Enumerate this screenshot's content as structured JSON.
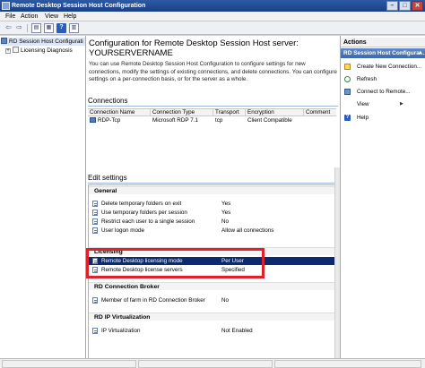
{
  "window": {
    "title": "Remote Desktop Session Host Configuration",
    "buttons": {
      "minimize": "–",
      "maximize": "□",
      "close": "✕"
    }
  },
  "menubar": {
    "items": [
      "File",
      "Action",
      "View",
      "Help"
    ]
  },
  "toolbar": {
    "back": "⇦",
    "forward": "⇨",
    "help": "?"
  },
  "tree": {
    "root": "RD Session Host Configurati",
    "child": "Licensing Diagnosis",
    "expander": "+"
  },
  "main": {
    "title": "Configuration for Remote Desktop Session Host server:",
    "server_name": "YOURSERVERNAME",
    "description": "You can use Remote Desktop Session Host Configuration to configure settings for new connections, modify the settings of existing connections, and delete connections. You can configure settings on a per-connection basis, or for the server as a whole.",
    "connections": {
      "title": "Connections",
      "columns": [
        "Connection Name",
        "Connection Type",
        "Transport",
        "Encryption",
        "Comment"
      ],
      "rows": [
        [
          "RDP-Tcp",
          "Microsoft RDP 7.1",
          "tcp",
          "Client Compatible",
          ""
        ]
      ]
    },
    "edit_settings": {
      "title": "Edit settings",
      "groups": [
        {
          "name": "General",
          "rows": [
            {
              "name": "Delete temporary folders on exit",
              "value": "Yes"
            },
            {
              "name": "Use temporary folders per session",
              "value": "Yes"
            },
            {
              "name": "Restrict each user to a single session",
              "value": "No"
            },
            {
              "name": "User logon mode",
              "value": "Allow all connections"
            }
          ]
        },
        {
          "name": "Licensing",
          "rows": [
            {
              "name": "Remote Desktop licensing mode",
              "value": "Per User"
            },
            {
              "name": "Remote Desktop license servers",
              "value": "Specified"
            }
          ]
        },
        {
          "name": "RD Connection Broker",
          "rows": [
            {
              "name": "Member of farm in RD Connection Broker",
              "value": "No"
            }
          ]
        },
        {
          "name": "RD IP Virtualization",
          "rows": [
            {
              "name": "IP Virtualization",
              "value": "Not Enabled"
            }
          ]
        }
      ]
    }
  },
  "actions": {
    "header": "Actions",
    "group": "RD Session Host Configura...",
    "items": [
      {
        "label": "Create New Connection..."
      },
      {
        "label": "Refresh"
      },
      {
        "label": "Connect to Remote..."
      },
      {
        "label": "View"
      },
      {
        "label": "Help"
      }
    ]
  },
  "colors": {
    "title_bar": "#1b3f86",
    "selection": "#0b2a6f",
    "actions_group": "#3c68ad",
    "highlight": "#e2202a"
  }
}
